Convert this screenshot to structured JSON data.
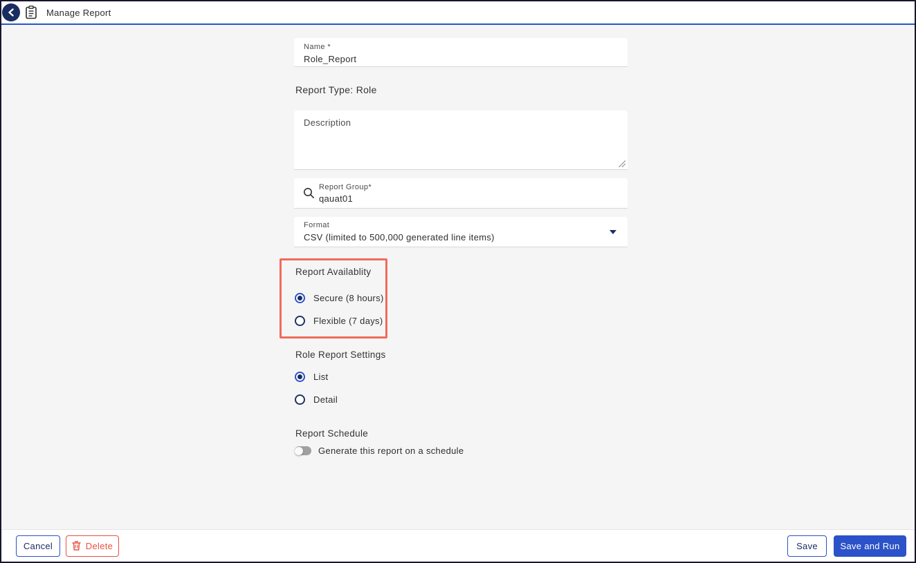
{
  "header": {
    "title": "Manage Report"
  },
  "form": {
    "name_field": {
      "label": "Name *",
      "value": "Role_Report"
    },
    "report_type_text": "Report Type: Role",
    "description_field": {
      "placeholder": "Description",
      "value": ""
    },
    "report_group_field": {
      "label": "Report Group*",
      "value": "qauat01",
      "icon": "search-icon"
    },
    "format_field": {
      "label": "Format",
      "value": "CSV (limited to 500,000 generated line items)",
      "icon": "chevron-down-icon"
    },
    "report_availability": {
      "heading": "Report Availablity",
      "options": [
        {
          "label": "Secure (8 hours)",
          "selected": true
        },
        {
          "label": "Flexible (7 days)",
          "selected": false
        }
      ],
      "highlight_color": "#f26a5a"
    },
    "role_report_settings": {
      "heading": "Role Report Settings",
      "options": [
        {
          "label": "List",
          "selected": true
        },
        {
          "label": "Detail",
          "selected": false
        }
      ]
    },
    "report_schedule": {
      "heading": "Report Schedule",
      "toggle_label": "Generate this report on a schedule",
      "toggle_on": false
    }
  },
  "footer": {
    "cancel_label": "Cancel",
    "delete_label": "Delete",
    "save_label": "Save",
    "save_and_run_label": "Save and Run"
  },
  "colors": {
    "accent_blue": "#2b52c8",
    "dark_navy": "#1a2d62",
    "delete_red": "#e8503f",
    "highlight_red": "#f26a5a",
    "page_background": "#f5f5f5"
  }
}
